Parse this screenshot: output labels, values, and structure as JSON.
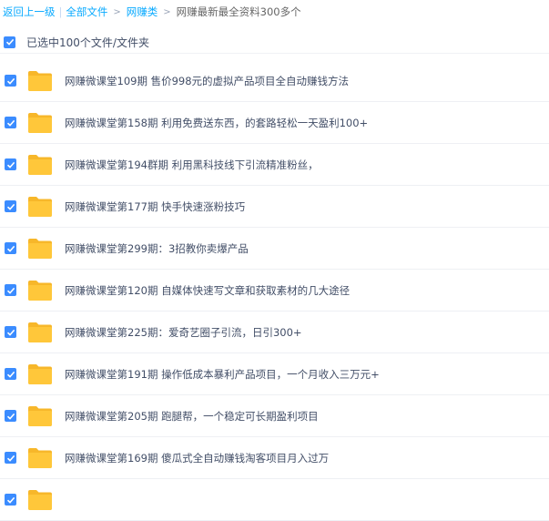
{
  "breadcrumb": {
    "back": "返回上一级",
    "all_files": "全部文件",
    "category": "网赚类",
    "current": "网赚最新最全资料300多个"
  },
  "selection": {
    "count_label": "已选中100个文件/文件夹"
  },
  "files": [
    {
      "name": "网赚微课堂109期 售价998元的虚拟产品项目全自动赚钱方法"
    },
    {
      "name": "网赚微课堂第158期 利用免费送东西，的套路轻松一天盈利100+"
    },
    {
      "name": "网赚微课堂第194群期 利用黑科技线下引流精准粉丝，"
    },
    {
      "name": "网赚微课堂第177期 快手快速涨粉技巧"
    },
    {
      "name": "网赚微课堂第299期：3招教你卖爆产品"
    },
    {
      "name": "网赚微课堂第120期 自媒体快速写文章和获取素材的几大途径"
    },
    {
      "name": "网赚微课堂第225期：爱奇艺圈子引流，日引300+"
    },
    {
      "name": "网赚微课堂第191期 操作低成本暴利产品项目，一个月收入三万元+"
    },
    {
      "name": "网赚微课堂第205期 跑腿帮，一个稳定可长期盈利项目"
    },
    {
      "name": "网赚微课堂第169期 傻瓜式全自动赚钱淘客项目月入过万"
    },
    {
      "name": ""
    }
  ],
  "colors": {
    "accent": "#3b8cff",
    "link": "#09aaff",
    "folder": "#ffc73a",
    "text": "#424e67"
  },
  "icons": {
    "checkbox": "checkbox-checked-icon",
    "folder": "folder-icon"
  }
}
